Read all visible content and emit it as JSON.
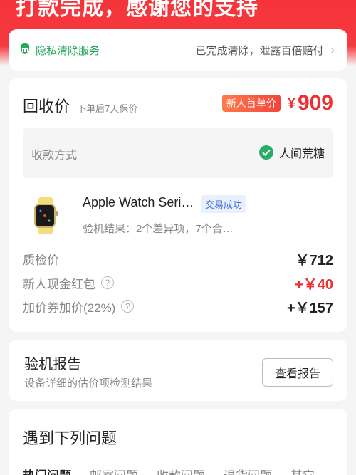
{
  "banner": {
    "title": "打款完成，感谢您的支持"
  },
  "privacy": {
    "service_label": "隐私清除服务",
    "status_text": "已完成清除，泄露百倍赔付",
    "icon": "shield-broom-icon"
  },
  "recycle": {
    "title": "回收价",
    "subtitle": "下单后7天保价",
    "badge": "新人首单价",
    "currency": "¥",
    "price": "909"
  },
  "payment": {
    "label": "收款方式",
    "account": "人间荒糖",
    "icon": "wechat-pay-icon"
  },
  "product": {
    "name": "Apple Watch Seri…",
    "status": "交易成功",
    "desc": "验机结果：2个差异项，7个合…"
  },
  "price_rows": [
    {
      "label": "质检价",
      "value": "￥712",
      "help": false
    },
    {
      "label": "新人现金红包",
      "value": "+￥40",
      "help": true
    },
    {
      "label": "加价券加价(22%)",
      "value": "+￥157",
      "help": true
    }
  ],
  "report": {
    "title": "验机报告",
    "subtitle": "设备详细的估价项检测结果",
    "button": "查看报告"
  },
  "issues": {
    "title": "遇到下列问题",
    "tabs": [
      "热门问题",
      "邮寄问题",
      "收款问题",
      "退货问题",
      "其它"
    ]
  },
  "colors": {
    "accent_red": "#f02d31",
    "green": "#27a85a",
    "status_blue": "#3a6fd8"
  }
}
